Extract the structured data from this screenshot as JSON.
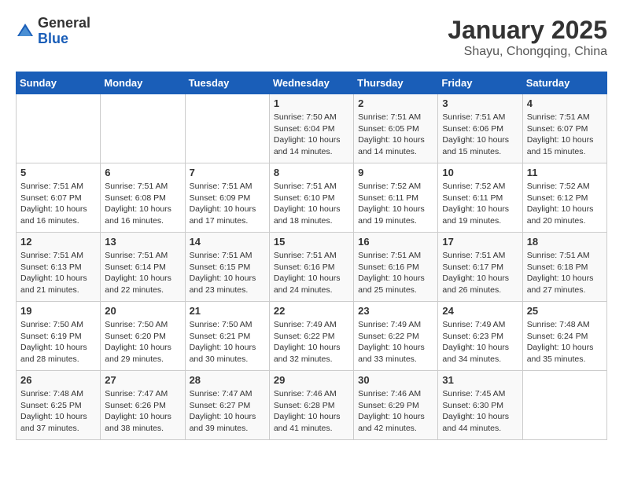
{
  "logo": {
    "line1": "General",
    "line2": "Blue"
  },
  "title": "January 2025",
  "subtitle": "Shayu, Chongqing, China",
  "days_of_week": [
    "Sunday",
    "Monday",
    "Tuesday",
    "Wednesday",
    "Thursday",
    "Friday",
    "Saturday"
  ],
  "weeks": [
    [
      {
        "day": "",
        "info": ""
      },
      {
        "day": "",
        "info": ""
      },
      {
        "day": "",
        "info": ""
      },
      {
        "day": "1",
        "info": "Sunrise: 7:50 AM\nSunset: 6:04 PM\nDaylight: 10 hours and 14 minutes."
      },
      {
        "day": "2",
        "info": "Sunrise: 7:51 AM\nSunset: 6:05 PM\nDaylight: 10 hours and 14 minutes."
      },
      {
        "day": "3",
        "info": "Sunrise: 7:51 AM\nSunset: 6:06 PM\nDaylight: 10 hours and 15 minutes."
      },
      {
        "day": "4",
        "info": "Sunrise: 7:51 AM\nSunset: 6:07 PM\nDaylight: 10 hours and 15 minutes."
      }
    ],
    [
      {
        "day": "5",
        "info": "Sunrise: 7:51 AM\nSunset: 6:07 PM\nDaylight: 10 hours and 16 minutes."
      },
      {
        "day": "6",
        "info": "Sunrise: 7:51 AM\nSunset: 6:08 PM\nDaylight: 10 hours and 16 minutes."
      },
      {
        "day": "7",
        "info": "Sunrise: 7:51 AM\nSunset: 6:09 PM\nDaylight: 10 hours and 17 minutes."
      },
      {
        "day": "8",
        "info": "Sunrise: 7:51 AM\nSunset: 6:10 PM\nDaylight: 10 hours and 18 minutes."
      },
      {
        "day": "9",
        "info": "Sunrise: 7:52 AM\nSunset: 6:11 PM\nDaylight: 10 hours and 19 minutes."
      },
      {
        "day": "10",
        "info": "Sunrise: 7:52 AM\nSunset: 6:11 PM\nDaylight: 10 hours and 19 minutes."
      },
      {
        "day": "11",
        "info": "Sunrise: 7:52 AM\nSunset: 6:12 PM\nDaylight: 10 hours and 20 minutes."
      }
    ],
    [
      {
        "day": "12",
        "info": "Sunrise: 7:51 AM\nSunset: 6:13 PM\nDaylight: 10 hours and 21 minutes."
      },
      {
        "day": "13",
        "info": "Sunrise: 7:51 AM\nSunset: 6:14 PM\nDaylight: 10 hours and 22 minutes."
      },
      {
        "day": "14",
        "info": "Sunrise: 7:51 AM\nSunset: 6:15 PM\nDaylight: 10 hours and 23 minutes."
      },
      {
        "day": "15",
        "info": "Sunrise: 7:51 AM\nSunset: 6:16 PM\nDaylight: 10 hours and 24 minutes."
      },
      {
        "day": "16",
        "info": "Sunrise: 7:51 AM\nSunset: 6:16 PM\nDaylight: 10 hours and 25 minutes."
      },
      {
        "day": "17",
        "info": "Sunrise: 7:51 AM\nSunset: 6:17 PM\nDaylight: 10 hours and 26 minutes."
      },
      {
        "day": "18",
        "info": "Sunrise: 7:51 AM\nSunset: 6:18 PM\nDaylight: 10 hours and 27 minutes."
      }
    ],
    [
      {
        "day": "19",
        "info": "Sunrise: 7:50 AM\nSunset: 6:19 PM\nDaylight: 10 hours and 28 minutes."
      },
      {
        "day": "20",
        "info": "Sunrise: 7:50 AM\nSunset: 6:20 PM\nDaylight: 10 hours and 29 minutes."
      },
      {
        "day": "21",
        "info": "Sunrise: 7:50 AM\nSunset: 6:21 PM\nDaylight: 10 hours and 30 minutes."
      },
      {
        "day": "22",
        "info": "Sunrise: 7:49 AM\nSunset: 6:22 PM\nDaylight: 10 hours and 32 minutes."
      },
      {
        "day": "23",
        "info": "Sunrise: 7:49 AM\nSunset: 6:22 PM\nDaylight: 10 hours and 33 minutes."
      },
      {
        "day": "24",
        "info": "Sunrise: 7:49 AM\nSunset: 6:23 PM\nDaylight: 10 hours and 34 minutes."
      },
      {
        "day": "25",
        "info": "Sunrise: 7:48 AM\nSunset: 6:24 PM\nDaylight: 10 hours and 35 minutes."
      }
    ],
    [
      {
        "day": "26",
        "info": "Sunrise: 7:48 AM\nSunset: 6:25 PM\nDaylight: 10 hours and 37 minutes."
      },
      {
        "day": "27",
        "info": "Sunrise: 7:47 AM\nSunset: 6:26 PM\nDaylight: 10 hours and 38 minutes."
      },
      {
        "day": "28",
        "info": "Sunrise: 7:47 AM\nSunset: 6:27 PM\nDaylight: 10 hours and 39 minutes."
      },
      {
        "day": "29",
        "info": "Sunrise: 7:46 AM\nSunset: 6:28 PM\nDaylight: 10 hours and 41 minutes."
      },
      {
        "day": "30",
        "info": "Sunrise: 7:46 AM\nSunset: 6:29 PM\nDaylight: 10 hours and 42 minutes."
      },
      {
        "day": "31",
        "info": "Sunrise: 7:45 AM\nSunset: 6:30 PM\nDaylight: 10 hours and 44 minutes."
      },
      {
        "day": "",
        "info": ""
      }
    ]
  ]
}
